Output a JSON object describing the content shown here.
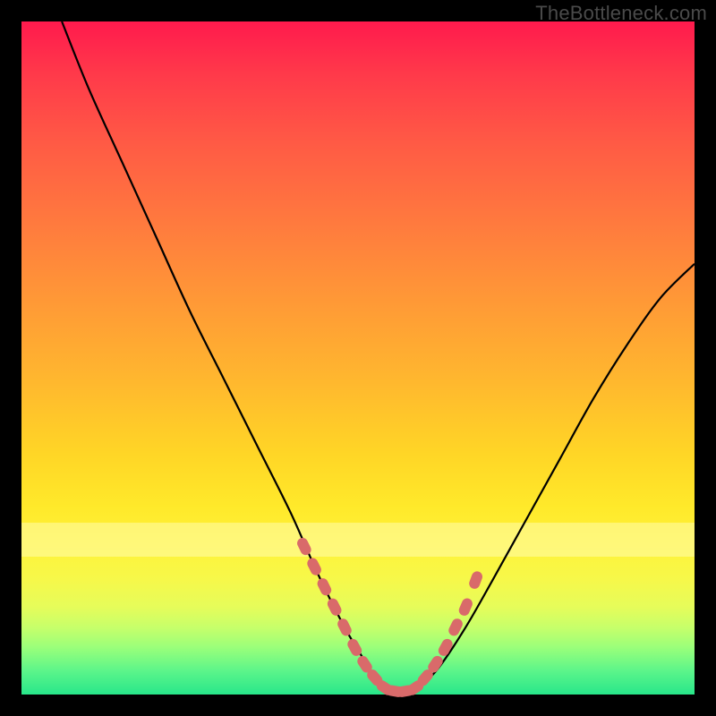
{
  "watermark": "TheBottleneck.com",
  "colors": {
    "curve": "#000000",
    "marker": "#d96a6a",
    "frame_bg_top": "#ff1a4d",
    "frame_bg_bottom": "#28e68a",
    "page_bg": "#000000"
  },
  "chart_data": {
    "type": "line",
    "title": "",
    "xlabel": "",
    "ylabel": "",
    "xlim": [
      0,
      100
    ],
    "ylim": [
      0,
      100
    ],
    "grid": false,
    "legend": false,
    "series": [
      {
        "name": "bottleneck-curve",
        "x": [
          6,
          10,
          15,
          20,
          25,
          30,
          35,
          40,
          44,
          48,
          51,
          53,
          55,
          57,
          59,
          62,
          66,
          70,
          75,
          80,
          85,
          90,
          95,
          100
        ],
        "values": [
          100,
          90,
          79,
          68,
          57,
          47,
          37,
          27,
          18,
          10,
          5,
          2,
          0,
          0,
          1,
          4,
          10,
          17,
          26,
          35,
          44,
          52,
          59,
          64
        ]
      }
    ],
    "markers": {
      "name": "overlay-dots",
      "x": [
        42,
        43.5,
        45,
        46.5,
        48,
        49.5,
        51,
        52.5,
        54,
        55.5,
        57,
        58.5,
        60,
        61.5,
        63,
        64.5,
        66,
        67.5
      ],
      "values": [
        22,
        19,
        16,
        13,
        10,
        7,
        4.5,
        2.5,
        1,
        0.5,
        0.5,
        1,
        2.5,
        4.5,
        7,
        10,
        13,
        17
      ]
    }
  }
}
